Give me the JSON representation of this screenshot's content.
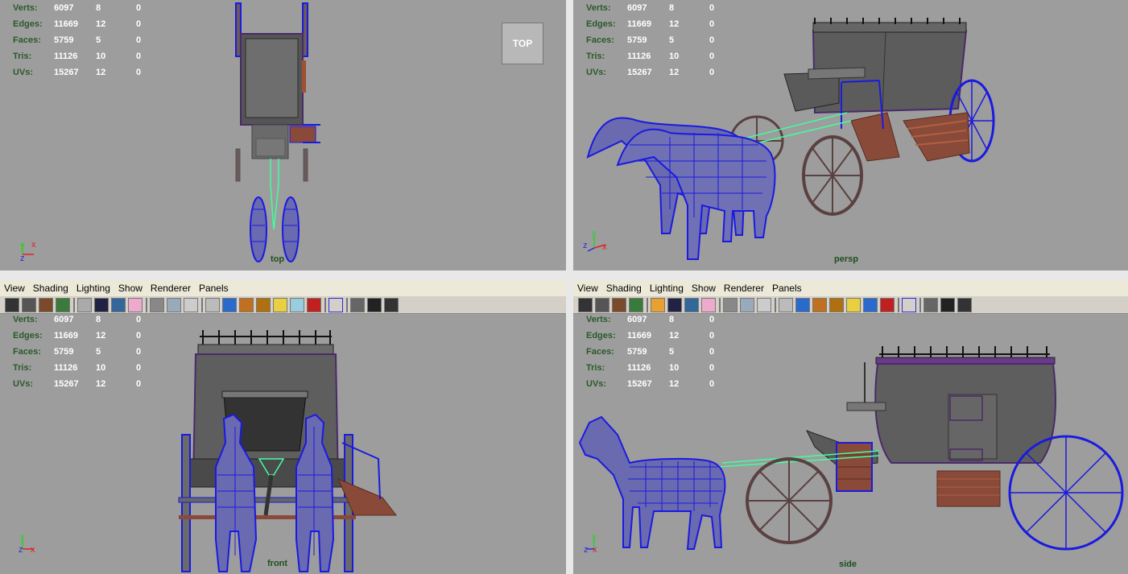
{
  "menus": [
    "View",
    "Shading",
    "Lighting",
    "Show",
    "Renderer",
    "Panels"
  ],
  "hud": {
    "rows": [
      {
        "label": "Verts:",
        "total": "6097",
        "selected": "8",
        "comp": "0"
      },
      {
        "label": "Edges:",
        "total": "11669",
        "selected": "12",
        "comp": "0"
      },
      {
        "label": "Faces:",
        "total": "5759",
        "selected": "5",
        "comp": "0"
      },
      {
        "label": "Tris:",
        "total": "11126",
        "selected": "10",
        "comp": "0"
      },
      {
        "label": "UVs:",
        "total": "15267",
        "selected": "12",
        "comp": "0"
      }
    ]
  },
  "viewports": {
    "top": {
      "camera": "top",
      "viewcube": "TOP"
    },
    "persp": {
      "camera": "persp"
    },
    "front": {
      "camera": "front"
    },
    "side": {
      "camera": "side"
    }
  },
  "axis_labels": {
    "x": "x",
    "y": "y",
    "z": "z"
  },
  "toolbar_icons": [
    "select-camera-icon",
    "camera-attributes-icon",
    "bookmarks-icon",
    "image-plane-icon",
    "grid-icon",
    "film-gate-icon",
    "resolution-gate-icon",
    "gate-mask-icon",
    "field-chart-icon",
    "safe-action-icon",
    "safe-title-icon",
    "wireframe-icon",
    "smooth-shade-icon",
    "flat-shade-icon",
    "bounding-box-icon",
    "default-lighting-icon",
    "textures-icon",
    "shadows-icon",
    "xray-icon",
    "isolate-select-icon",
    "xray-joints-icon",
    "wireframe-on-shaded-icon",
    "hud-icon"
  ],
  "colors": {
    "viewport_bg": "#9d9d9d",
    "menu_bg": "#ece9d8",
    "mesh_blue": "#1a1ae0",
    "wood": "#8a4a3a",
    "coach": "#5a5a5a",
    "green_wire": "#40ffa0"
  }
}
